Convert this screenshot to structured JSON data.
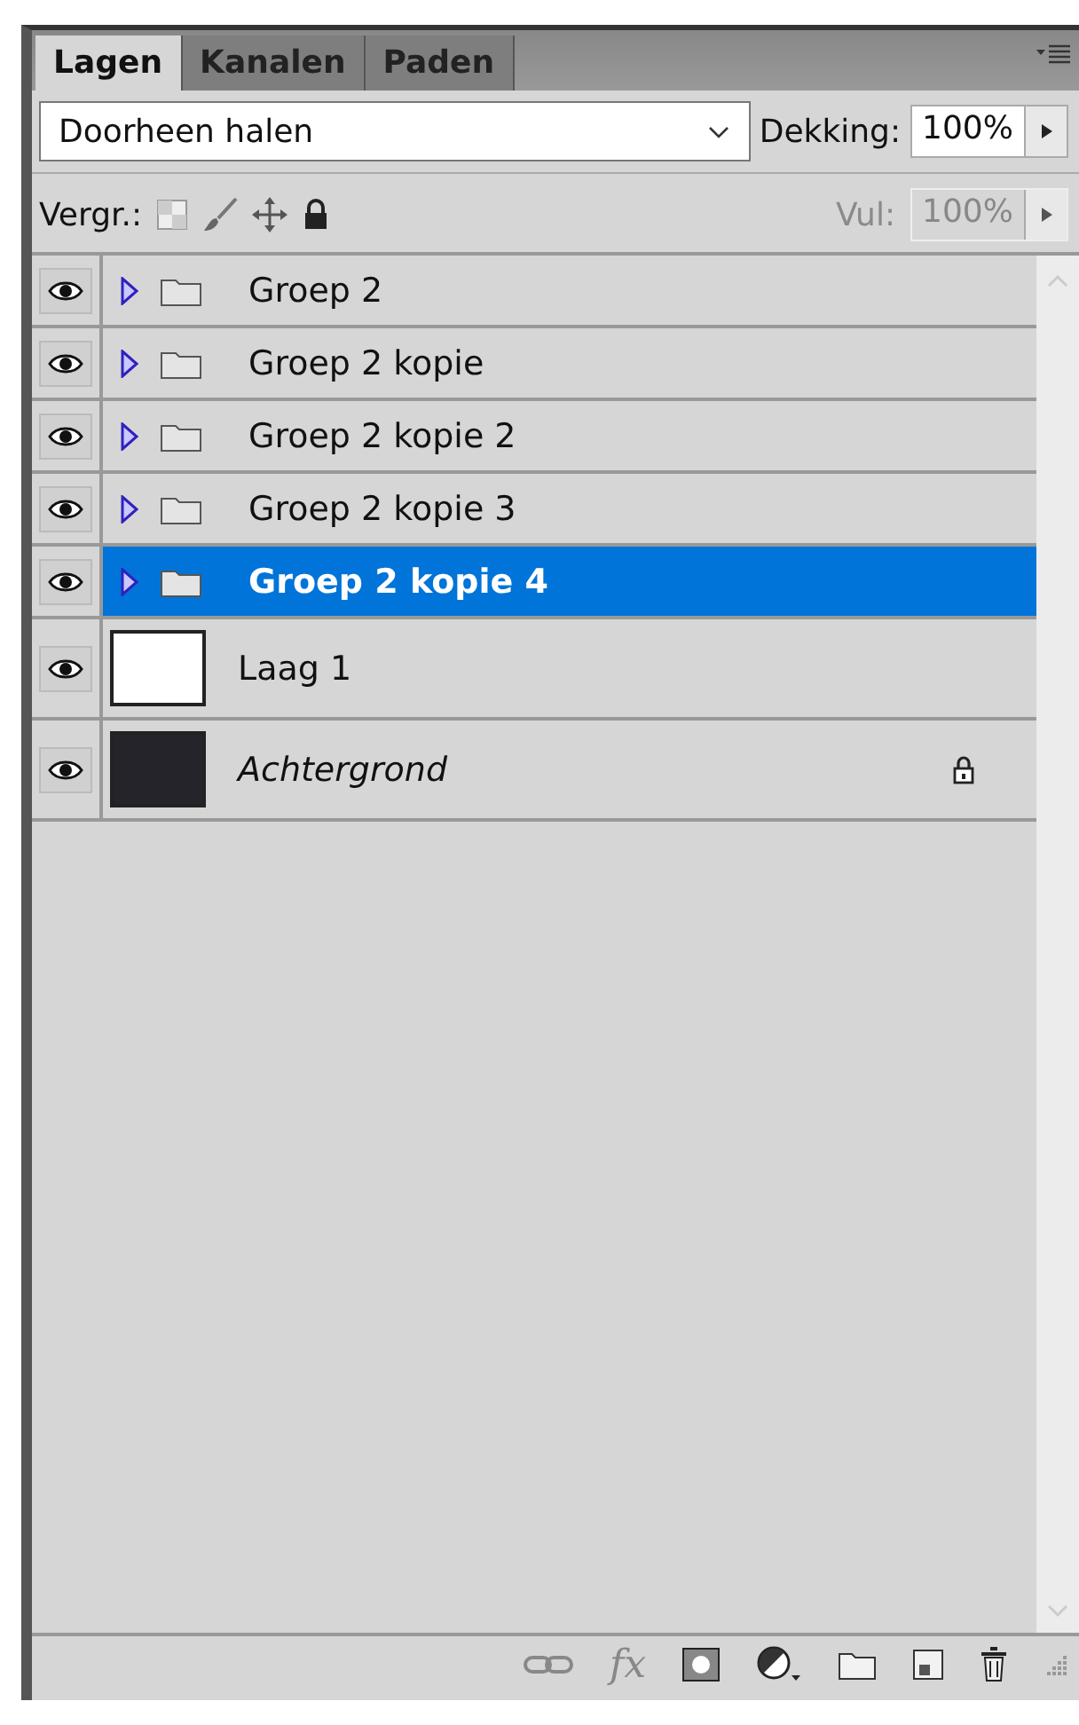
{
  "tabs": [
    {
      "label": "Lagen",
      "selected": true
    },
    {
      "label": "Kanalen",
      "selected": false
    },
    {
      "label": "Paden",
      "selected": false
    }
  ],
  "blend_mode": {
    "value": "Doorheen halen"
  },
  "opacity": {
    "label": "Dekking:",
    "value": "100%",
    "disabled": false
  },
  "lock": {
    "label": "Vergr.:"
  },
  "fill": {
    "label": "Vul:",
    "value": "100%",
    "disabled": true
  },
  "layers": [
    {
      "kind": "group",
      "name": "Groep 2",
      "visible": true,
      "selected": false
    },
    {
      "kind": "group",
      "name": "Groep 2 kopie",
      "visible": true,
      "selected": false
    },
    {
      "kind": "group",
      "name": "Groep 2 kopie 2",
      "visible": true,
      "selected": false
    },
    {
      "kind": "group",
      "name": "Groep 2 kopie 3",
      "visible": true,
      "selected": false
    },
    {
      "kind": "group",
      "name": "Groep 2 kopie 4",
      "visible": true,
      "selected": true
    },
    {
      "kind": "layer",
      "name": "Laag 1",
      "visible": true,
      "selected": false,
      "color": "#ffffff",
      "locked": false
    },
    {
      "kind": "background",
      "name": "Achtergrond",
      "visible": true,
      "selected": false,
      "color": "#25242a",
      "locked": true
    }
  ],
  "footer": {
    "fx_label": "fx"
  }
}
